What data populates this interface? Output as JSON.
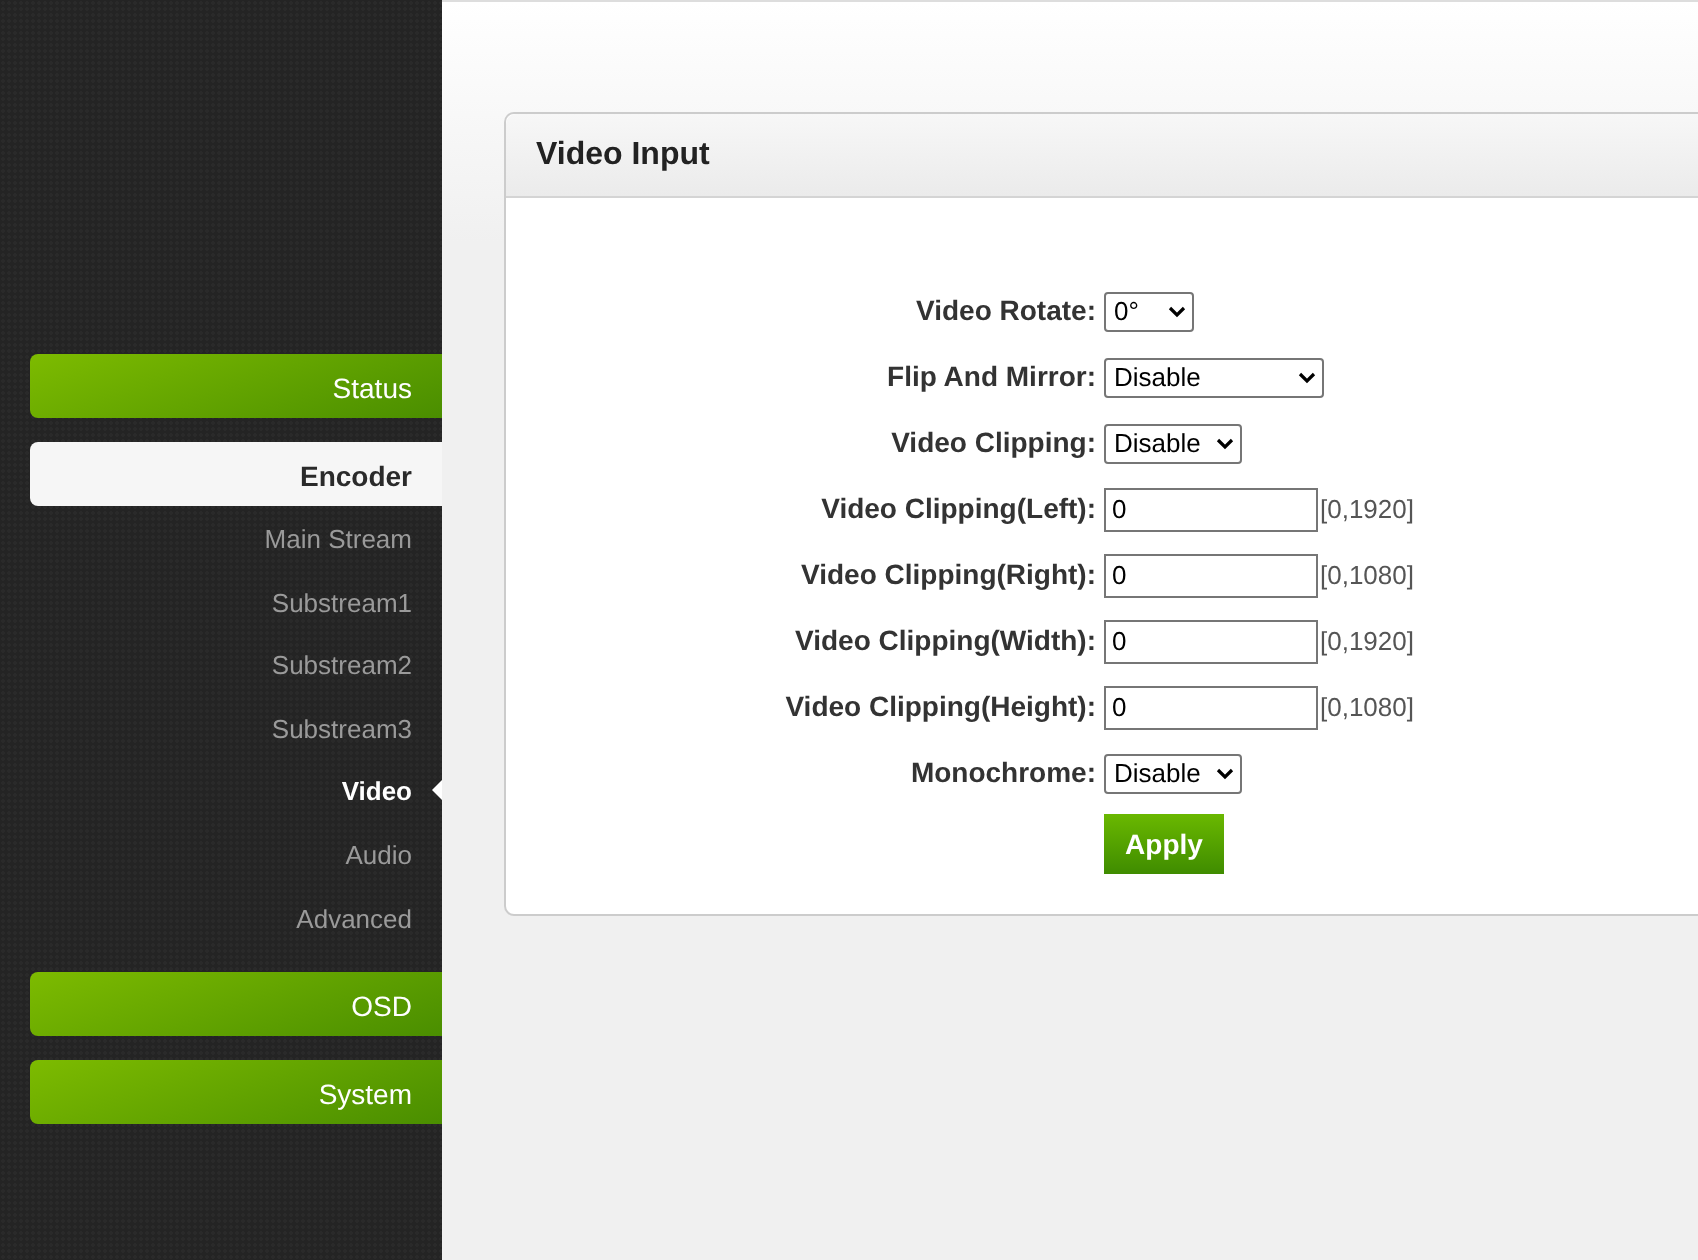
{
  "sidebar": {
    "groups": [
      {
        "label": "Status",
        "expanded": false
      },
      {
        "label": "Encoder",
        "expanded": true,
        "children": [
          {
            "label": "Main Stream",
            "selected": false
          },
          {
            "label": "Substream1",
            "selected": false
          },
          {
            "label": "Substream2",
            "selected": false
          },
          {
            "label": "Substream3",
            "selected": false
          },
          {
            "label": "Video",
            "selected": true
          },
          {
            "label": "Audio",
            "selected": false
          },
          {
            "label": "Advanced",
            "selected": false
          }
        ]
      },
      {
        "label": "OSD",
        "expanded": false
      },
      {
        "label": "System",
        "expanded": false
      }
    ]
  },
  "panel": {
    "title": "Video Input",
    "fields": [
      {
        "kind": "select",
        "label": "Video Rotate:",
        "value": "0°"
      },
      {
        "kind": "select",
        "label": "Flip And Mirror:",
        "value": "Disable"
      },
      {
        "kind": "select",
        "label": "Video Clipping:",
        "value": "Disable"
      },
      {
        "kind": "input",
        "label": "Video Clipping(Left):",
        "value": "0",
        "range": "[0,1920]"
      },
      {
        "kind": "input",
        "label": "Video Clipping(Right):",
        "value": "0",
        "range": "[0,1080]"
      },
      {
        "kind": "input",
        "label": "Video Clipping(Width):",
        "value": "0",
        "range": "[0,1920]"
      },
      {
        "kind": "input",
        "label": "Video Clipping(Height):",
        "value": "0",
        "range": "[0,1080]"
      },
      {
        "kind": "select",
        "label": "Monochrome:",
        "value": "Disable"
      }
    ],
    "apply_button": "Apply"
  }
}
